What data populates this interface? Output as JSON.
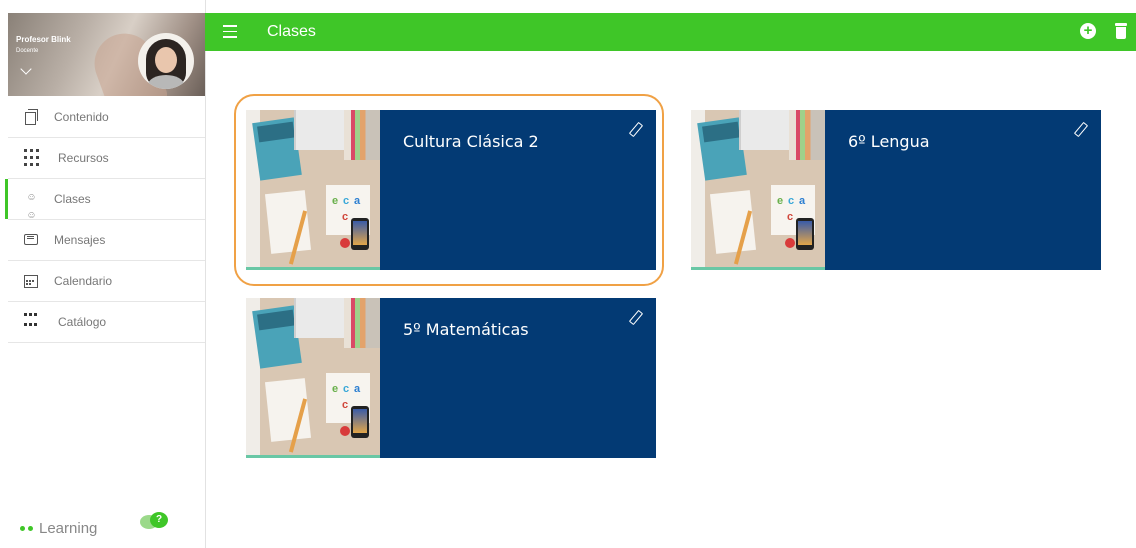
{
  "sidebar": {
    "profile": {
      "name": "Profesor Blink",
      "role": "Docente"
    },
    "items": [
      {
        "label": "Contenido",
        "icon": "copy-icon"
      },
      {
        "label": "Recursos",
        "icon": "grid-icon"
      },
      {
        "label": "Clases",
        "icon": "people-icon",
        "active": true
      },
      {
        "label": "Mensajes",
        "icon": "message-icon"
      },
      {
        "label": "Calendario",
        "icon": "calendar-icon"
      },
      {
        "label": "Catálogo",
        "icon": "catalog-icon"
      }
    ],
    "footer": {
      "logo_text": "Learning",
      "help_badge": "?"
    }
  },
  "topbar": {
    "title": "Clases",
    "add_icon": "plus-circle-icon",
    "delete_icon": "trash-icon",
    "background": "#3fc628"
  },
  "classes": [
    {
      "name": "Cultura Clásica 2",
      "selected": true
    },
    {
      "name": "6º Lengua",
      "selected": false
    },
    {
      "name": "5º Matemáticas",
      "selected": false
    }
  ],
  "colors": {
    "accent": "#3fc628",
    "card_bg": "#033a74",
    "selection": "#f0a145"
  }
}
